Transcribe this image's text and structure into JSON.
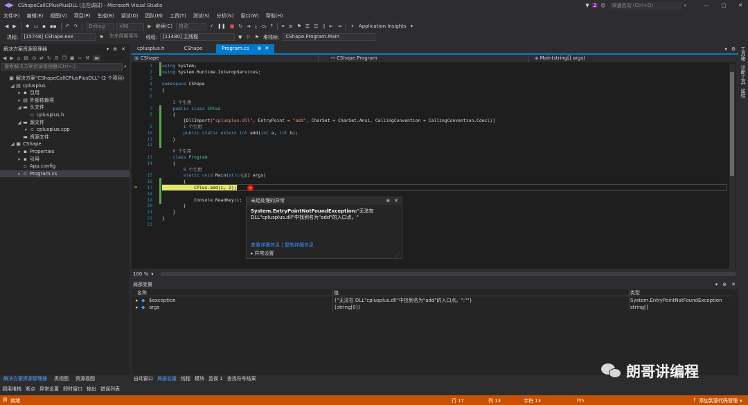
{
  "title": {
    "window_title": "CShapeCallCPlusPlusDLL (正在调试) - Microsoft Visual Studio",
    "notif_count": "2",
    "quick_launch": "快速启动 (Ctrl+Q)",
    "login": "登录",
    "min": "—",
    "max": "□",
    "close": "✕"
  },
  "menu": [
    "文件(F)",
    "编辑(E)",
    "视图(V)",
    "项目(P)",
    "生成(B)",
    "调试(D)",
    "团队(M)",
    "工具(T)",
    "测试(S)",
    "分析(N)",
    "窗口(W)",
    "帮助(H)"
  ],
  "toolbar": {
    "config": "Debug",
    "platform": "x86",
    "continue": "继续(C)",
    "auto": "自动",
    "app_insights": "Application Insights"
  },
  "toolbar2": {
    "process_label": "进程:",
    "process": "[15748] CShape.exe",
    "lifecycle": "生命周期事件",
    "thread_label": "线程:",
    "thread": "[11480] 主线程",
    "stack_label": "堆栈帧:",
    "stack": "CShape.Program.Main"
  },
  "solution_explorer": {
    "title": "解决方案资源管理器",
    "search": "搜索解决方案资源管理器(Ctrl+;)",
    "items": [
      {
        "label": "解决方案\"CShapeCallCPlusPlusDLL\" (2 个项目)",
        "indent": 0,
        "icon": "▣",
        "exp": ""
      },
      {
        "label": "cplusplus",
        "indent": 1,
        "icon": "▤",
        "exp": "◢"
      },
      {
        "label": "引用",
        "indent": 2,
        "icon": "▪",
        "exp": "▸"
      },
      {
        "label": "外部依赖项",
        "indent": 2,
        "icon": "▤",
        "exp": "▸"
      },
      {
        "label": "头文件",
        "indent": 2,
        "icon": "▬",
        "exp": "◢"
      },
      {
        "label": "cplusplus.h",
        "indent": 3,
        "icon": "▫",
        "exp": ""
      },
      {
        "label": "源文件",
        "indent": 2,
        "icon": "▬",
        "exp": "◢"
      },
      {
        "label": "cplusplus.cpp",
        "indent": 3,
        "icon": "▫",
        "exp": "▸"
      },
      {
        "label": "资源文件",
        "indent": 2,
        "icon": "▬",
        "exp": ""
      },
      {
        "label": "CShape",
        "indent": 1,
        "icon": "▣",
        "exp": "◢"
      },
      {
        "label": "Properties",
        "indent": 2,
        "icon": "▪",
        "exp": "▸"
      },
      {
        "label": "引用",
        "indent": 2,
        "icon": "▪",
        "exp": "▸"
      },
      {
        "label": "App.config",
        "indent": 2,
        "icon": "▫",
        "exp": ""
      },
      {
        "label": "Program.cs",
        "indent": 2,
        "icon": "▫",
        "exp": "▸"
      }
    ],
    "tabs": [
      "解决方案资源管理器",
      "类视图",
      "资源视图"
    ]
  },
  "right_bar": [
    "工具箱",
    "诊断工具",
    "属性"
  ],
  "editor": {
    "tabs": [
      "cplusplus.h",
      "CShape",
      "Program.cs"
    ],
    "pin": "⊕",
    "close": "✕",
    "nav": [
      "CShape",
      "CShape.Program",
      "Main(string[] args)"
    ],
    "line_numbers": [
      "1",
      "2",
      "3",
      "4",
      "5",
      "6",
      "",
      "7",
      "8",
      "",
      "9",
      "10",
      "11",
      "12",
      "",
      "13",
      "14",
      "",
      "15",
      "16",
      "17",
      "18",
      "19",
      "20",
      "21",
      "22",
      "23"
    ],
    "lines": [
      [
        [
          "kw",
          "using "
        ],
        [
          "",
          "System;"
        ]
      ],
      [
        [
          "kw",
          "using "
        ],
        [
          "",
          "System.Runtime.InteropServices;"
        ]
      ],
      [
        [
          "",
          ""
        ]
      ],
      [
        [
          "kw",
          "namespace "
        ],
        [
          "",
          "CShape"
        ]
      ],
      [
        [
          "",
          "{"
        ]
      ],
      [
        [
          "",
          ""
        ]
      ],
      [
        [
          "cm",
          "    1 个引用"
        ]
      ],
      [
        [
          "kw",
          "    public class "
        ],
        [
          "ty",
          "CPlus"
        ]
      ],
      [
        [
          "",
          "    {"
        ]
      ],
      [
        [
          "",
          "        [DllImport("
        ],
        [
          "st",
          "\"cplusplus.dll\""
        ],
        [
          "",
          ", EntryPoint = "
        ],
        [
          "st",
          "\"add\""
        ],
        [
          "",
          ", CharSet = CharSet.Ansi, CallingConvention = CallingConvention.Cdecl)]"
        ]
      ],
      [
        [
          "cm",
          "        1 个引用"
        ]
      ],
      [
        [
          "kw",
          "        public static extern int "
        ],
        [
          "",
          "add("
        ],
        [
          "kw",
          "int "
        ],
        [
          "",
          "a, "
        ],
        [
          "kw",
          "int "
        ],
        [
          "",
          "b);"
        ]
      ],
      [
        [
          "",
          "    }"
        ]
      ],
      [
        [
          "",
          ""
        ]
      ],
      [
        [
          "cm",
          "    0 个引用"
        ]
      ],
      [
        [
          "kw",
          "    class "
        ],
        [
          "ty",
          "Program"
        ]
      ],
      [
        [
          "",
          "    {"
        ]
      ],
      [
        [
          "cm",
          "        0 个引用"
        ]
      ],
      [
        [
          "kw",
          "        static void "
        ],
        [
          "",
          "Main("
        ],
        [
          "kw",
          "string"
        ],
        [
          "",
          "[] args)"
        ]
      ],
      [
        [
          "",
          "        {"
        ]
      ],
      [
        [
          "hl",
          "            CPlus.add(1, 2);"
        ]
      ],
      [
        [
          "",
          ""
        ]
      ],
      [
        [
          "",
          "            Console.ReadKey();"
        ]
      ],
      [
        [
          "",
          "        }"
        ]
      ],
      [
        [
          "",
          "    }"
        ]
      ],
      [
        [
          "",
          "}"
        ]
      ],
      [
        [
          "",
          ""
        ]
      ]
    ],
    "zoom": "100 %"
  },
  "exception": {
    "title": "未经处理的异常",
    "pin": "⊕",
    "close": "✕",
    "type": "System.EntryPointNotFoundException:",
    "msg1": "\"无法在",
    "msg2": "DLL\"cplusplus.dll\"中找到名为\"add\"的入口点。\"",
    "link1": "查看详细信息",
    "link2": "复制详细信息",
    "settings": "异常设置"
  },
  "locals": {
    "title": "局部变量",
    "cols": [
      "名称",
      "值",
      "类型"
    ],
    "rows": [
      {
        "name": "$exception",
        "value": "{\"无法在 DLL\"cplusplus.dll\"中找到名为\"add\"的入口点。\":\"\"}",
        "type": "System.EntryPointNotFoundException"
      },
      {
        "name": "args",
        "value": "{string[0]}",
        "type": "string[]"
      }
    ],
    "tabs": [
      "自动窗口",
      "局部变量",
      "线程",
      "模块",
      "监视 1",
      "查找符号结果"
    ]
  },
  "bottom_tabs": [
    "调用堆栈",
    "断点",
    "异常设置",
    "即时窗口",
    "输出",
    "错误列表"
  ],
  "status": {
    "ready": "就绪",
    "line": "行 17",
    "col": "列 13",
    "char": "字符 13",
    "ins": "Ins",
    "source": "添加到源代码管理"
  },
  "watermark": "朗哥讲编程"
}
